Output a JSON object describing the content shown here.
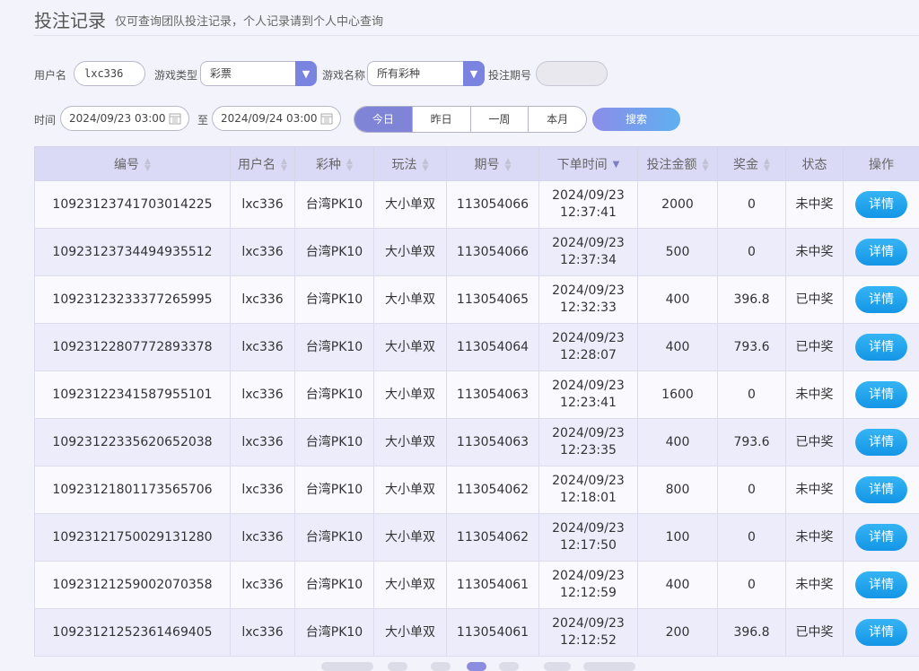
{
  "header": {
    "title": "投注记录",
    "subtitle": "仅可查询团队投注记录，个人记录请到个人中心查询"
  },
  "filters": {
    "username_label": "用户名",
    "username_value": "lxc336",
    "game_type_label": "游戏类型",
    "game_type_value": "彩票",
    "game_name_label": "游戏名称",
    "game_name_value": "所有彩种",
    "issue_label": "投注期号",
    "issue_value": "",
    "time_label": "时间",
    "start_time": "2024/09/23 03:00",
    "to_label": "至",
    "end_time": "2024/09/24 03:00",
    "quick_ranges": [
      "今日",
      "昨日",
      "一周",
      "本月"
    ],
    "search_label": "搜索"
  },
  "table": {
    "columns": [
      "编号",
      "用户名",
      "彩种",
      "玩法",
      "期号",
      "下单时间",
      "投注金额",
      "奖金",
      "状态",
      "操作"
    ],
    "detail_label": "详情",
    "rows": [
      {
        "id": "10923123741703014225",
        "user": "lxc336",
        "lottery": "台湾PK10",
        "play": "大小单双",
        "issue": "113054066",
        "date": "2024/09/23",
        "time": "12:37:41",
        "amount": "2000",
        "prize": "0",
        "status": "未中奖",
        "won": false
      },
      {
        "id": "10923123734494935512",
        "user": "lxc336",
        "lottery": "台湾PK10",
        "play": "大小单双",
        "issue": "113054066",
        "date": "2024/09/23",
        "time": "12:37:34",
        "amount": "500",
        "prize": "0",
        "status": "未中奖",
        "won": false
      },
      {
        "id": "10923123233377265995",
        "user": "lxc336",
        "lottery": "台湾PK10",
        "play": "大小单双",
        "issue": "113054065",
        "date": "2024/09/23",
        "time": "12:32:33",
        "amount": "400",
        "prize": "396.8",
        "status": "已中奖",
        "won": true
      },
      {
        "id": "10923122807772893378",
        "user": "lxc336",
        "lottery": "台湾PK10",
        "play": "大小单双",
        "issue": "113054064",
        "date": "2024/09/23",
        "time": "12:28:07",
        "amount": "400",
        "prize": "793.6",
        "status": "已中奖",
        "won": true
      },
      {
        "id": "10923122341587955101",
        "user": "lxc336",
        "lottery": "台湾PK10",
        "play": "大小单双",
        "issue": "113054063",
        "date": "2024/09/23",
        "time": "12:23:41",
        "amount": "1600",
        "prize": "0",
        "status": "未中奖",
        "won": false
      },
      {
        "id": "10923122335620652038",
        "user": "lxc336",
        "lottery": "台湾PK10",
        "play": "大小单双",
        "issue": "113054063",
        "date": "2024/09/23",
        "time": "12:23:35",
        "amount": "400",
        "prize": "793.6",
        "status": "已中奖",
        "won": true
      },
      {
        "id": "10923121801173565706",
        "user": "lxc336",
        "lottery": "台湾PK10",
        "play": "大小单双",
        "issue": "113054062",
        "date": "2024/09/23",
        "time": "12:18:01",
        "amount": "800",
        "prize": "0",
        "status": "未中奖",
        "won": false
      },
      {
        "id": "10923121750029131280",
        "user": "lxc336",
        "lottery": "台湾PK10",
        "play": "大小单双",
        "issue": "113054062",
        "date": "2024/09/23",
        "time": "12:17:50",
        "amount": "100",
        "prize": "0",
        "status": "未中奖",
        "won": false
      },
      {
        "id": "10923121259002070358",
        "user": "lxc336",
        "lottery": "台湾PK10",
        "play": "大小单双",
        "issue": "113054061",
        "date": "2024/09/23",
        "time": "12:12:59",
        "amount": "400",
        "prize": "0",
        "status": "未中奖",
        "won": false
      },
      {
        "id": "10923121252361469405",
        "user": "lxc336",
        "lottery": "台湾PK10",
        "play": "大小单双",
        "issue": "113054061",
        "date": "2024/09/23",
        "time": "12:12:52",
        "amount": "200",
        "prize": "396.8",
        "status": "已中奖",
        "won": true
      }
    ]
  },
  "colors": {
    "accent": "#7f84d6",
    "won": "#e4554f",
    "detail_button": "#1ea2ec"
  }
}
